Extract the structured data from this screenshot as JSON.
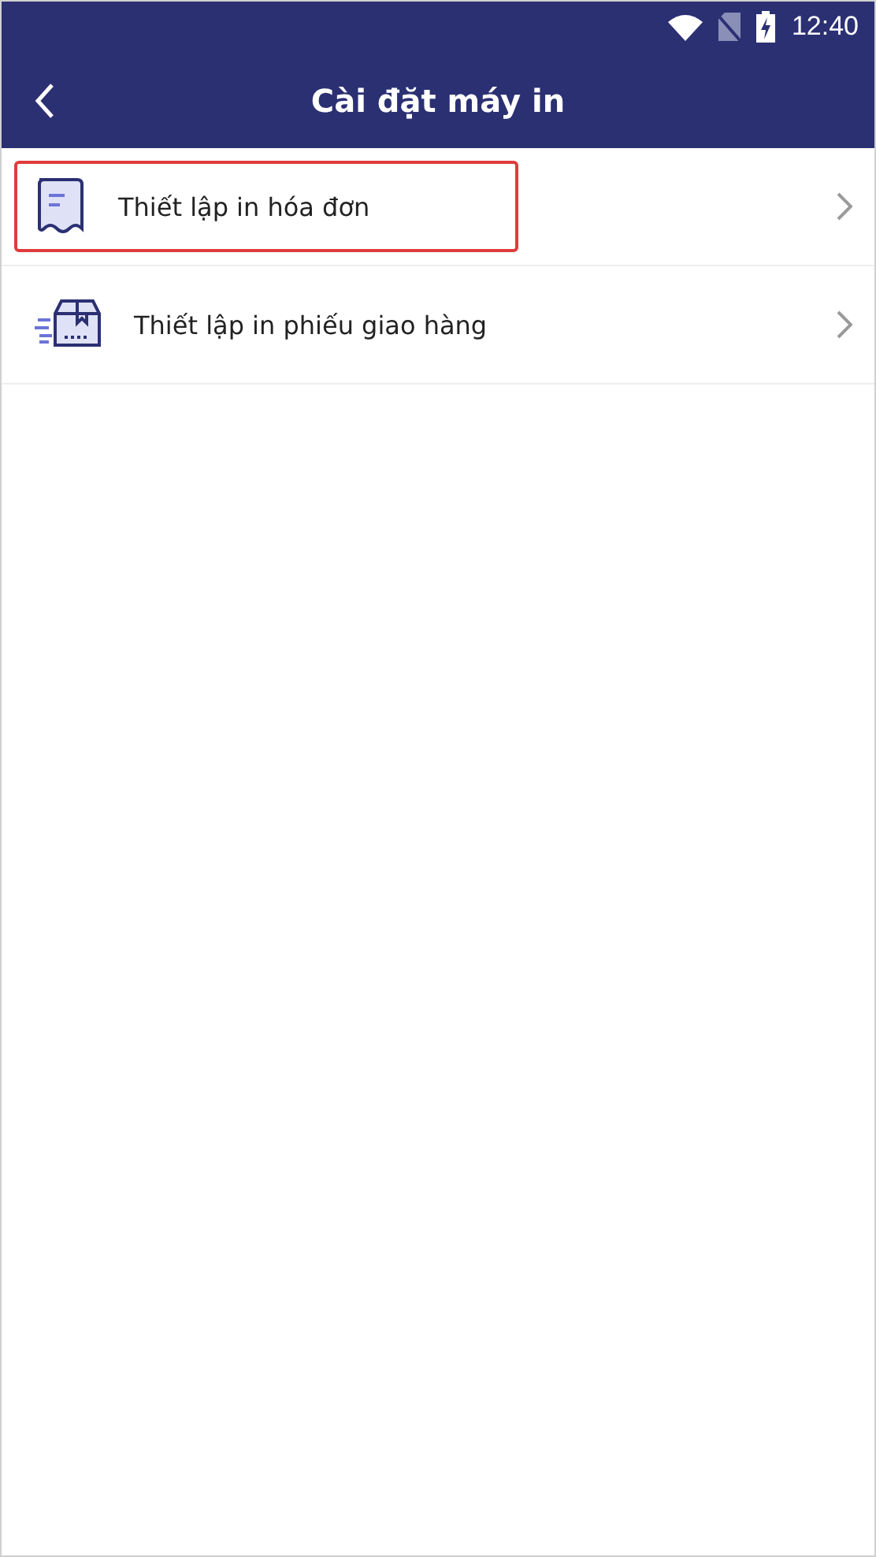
{
  "status_bar": {
    "time": "12:40"
  },
  "header": {
    "title": "Cài đặt máy in"
  },
  "items": [
    {
      "kind": "receipt",
      "label": "Thiết lập in hóa đơn",
      "selected": true
    },
    {
      "kind": "box",
      "label": "Thiết lập in phiếu giao hàng",
      "selected": false
    }
  ]
}
